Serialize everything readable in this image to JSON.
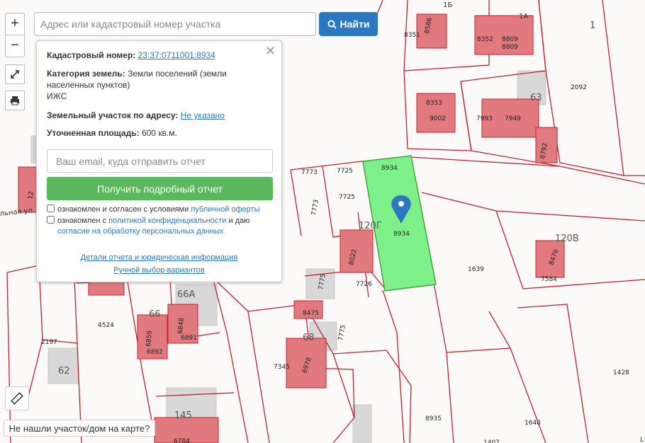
{
  "search": {
    "placeholder": "Адрес или кадастровый номер участка",
    "button_label": "Найти"
  },
  "controls": {
    "zoom_in": "+",
    "zoom_out": "−"
  },
  "panel": {
    "cadastral_label": "Кадастровый номер:",
    "cadastral_value": "23:37:0711001:8934",
    "category_label": "Категория земель:",
    "category_value": "Земли поселений (земли населенных пунктов)",
    "category_use": "ИЖС",
    "address_label": "Земельный участок по адресу:",
    "address_value": "Не указано",
    "area_label": "Уточненная площадь:",
    "area_value": "600 кв.м.",
    "email_placeholder": "Ваш email, куда отправить отчет",
    "submit_label": "Получить подробный отчет",
    "consent1_text": "ознакомлен и согласен с условиями ",
    "consent1_link": "публичной оферты",
    "consent2_text": "ознакомлен с ",
    "consent2_link": "политикой конфиденциальности",
    "consent2_mid": " и даю",
    "consent2_link2": "согласие на обработку персональных данных",
    "details_link": "Детали отчета и юридическая информация",
    "manual_link": "Ручной выбор вариантов"
  },
  "not_found_label": "Не нашли участок/дом на карте?",
  "map": {
    "selected_parcel": "8934",
    "street_label": "льная ул",
    "labels": [
      "1Б",
      "1А",
      "1",
      "8351",
      "8586",
      "8352",
      "8809",
      "8809",
      "8353",
      "9002",
      "7993",
      "7949",
      "63",
      "2092",
      "8792",
      "7773",
      "7725",
      "8934",
      "7725",
      "7773",
      "120Г",
      "8934",
      "8022",
      "7726",
      "7775",
      "1639",
      "120В",
      "8476",
      "7584",
      "66А",
      "66",
      "6848",
      "6891",
      "6859",
      "6892",
      "4524",
      "2197",
      "62",
      "8475",
      "68",
      "7775",
      "7345",
      "6978",
      "1428",
      "8935",
      "1640",
      "145",
      "6784",
      "1407",
      "L"
    ]
  },
  "colors": {
    "parcel_border": "#c81e2b",
    "building": "#e07a7f",
    "selected_fill": "#7ef08a",
    "button_blue": "#2b78c0",
    "button_green": "#5cb85c"
  }
}
